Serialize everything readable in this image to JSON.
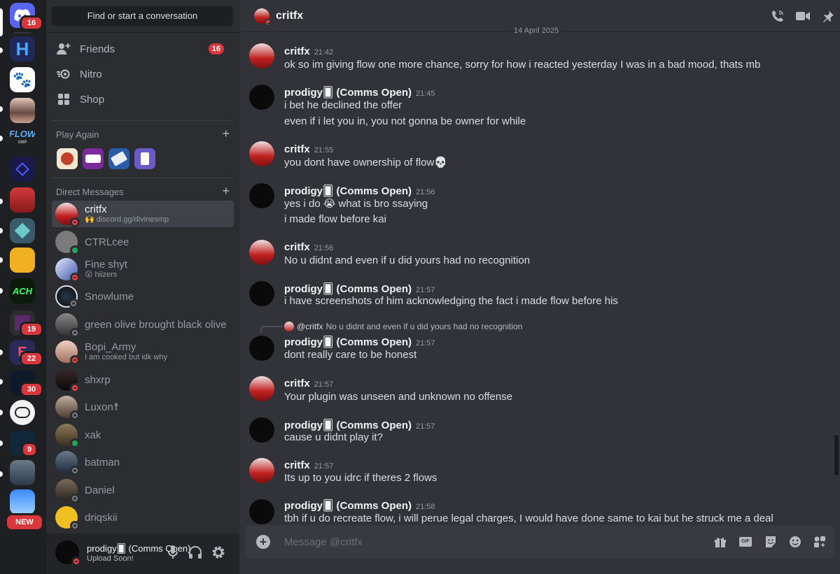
{
  "colors": {
    "accent": "#5865f2",
    "danger": "#da373c",
    "online": "#23a55a"
  },
  "rail": {
    "home_badge": "16",
    "servers": [
      {
        "name": "h-server",
        "badge": ""
      },
      {
        "name": "paw-server",
        "badge": ""
      },
      {
        "name": "photo-server",
        "badge": ""
      },
      {
        "name": "flow-server",
        "label": "FLOW",
        "sub": "SMP",
        "badge": ""
      },
      {
        "name": "blue-server",
        "badge": ""
      },
      {
        "name": "red-hat-server",
        "badge": ""
      },
      {
        "name": "crystal-server",
        "badge": ""
      },
      {
        "name": "gold-server",
        "badge": ""
      },
      {
        "name": "ach-server",
        "label": "ACH",
        "badge": ""
      },
      {
        "name": "purple-server",
        "badge": "19"
      },
      {
        "name": "e-server",
        "badge": "22"
      },
      {
        "name": "dark-server",
        "badge": "30"
      },
      {
        "name": "skull-server",
        "badge": ""
      },
      {
        "name": "night-server",
        "badge": "9"
      },
      {
        "name": "game-server",
        "badge": ""
      },
      {
        "name": "cyan-server",
        "badge": ""
      }
    ],
    "new_label": "NEW"
  },
  "sidebar": {
    "search_placeholder": "Find or start a conversation",
    "nav": [
      {
        "label": "Friends",
        "count": "16"
      },
      {
        "label": "Nitro",
        "count": ""
      },
      {
        "label": "Shop",
        "count": ""
      }
    ],
    "play_again": "Play Again",
    "direct_messages": "Direct Messages",
    "dms": [
      {
        "name": "critfx",
        "sub": "🙌 discord.gg/divinesmp",
        "status": "dnd"
      },
      {
        "name": "CTRLcee",
        "sub": "",
        "status": "online"
      },
      {
        "name": "Fine shyt",
        "sub": "😲 hiizers",
        "status": "dnd"
      },
      {
        "name": "Snowlume",
        "sub": "",
        "status": "off"
      },
      {
        "name": "green olive brought black olive",
        "sub": "",
        "status": "off"
      },
      {
        "name": "Bopi_Army",
        "sub": "I am cooked but idk why",
        "status": "dnd"
      },
      {
        "name": "shxrp",
        "sub": "",
        "status": "dnd"
      },
      {
        "name": "Luxon☨",
        "sub": "",
        "status": "off"
      },
      {
        "name": "xak",
        "sub": "",
        "status": "online"
      },
      {
        "name": "batman",
        "sub": "",
        "status": "off"
      },
      {
        "name": "Daniel",
        "sub": "",
        "status": "off"
      },
      {
        "name": "driqskii",
        "sub": "",
        "status": "off"
      }
    ]
  },
  "user": {
    "name": "prodigy🂠 (Comms Open)",
    "status": "Upload Soon!"
  },
  "header": {
    "name": "critfx"
  },
  "chat": {
    "date_divider": "14 April 2025",
    "messages": [
      {
        "author": "critfx",
        "time": "21:42",
        "lines": [
          "ok so im giving flow one more chance, sorry for how i reacted yesterday I was in a bad mood, thats mb"
        ]
      },
      {
        "author": "prodigy🂠 (Comms Open)",
        "time": "21:45",
        "lines": [
          "i bet he declined the offer",
          "even if i let you in, you not gonna be owner for while"
        ]
      },
      {
        "author": "critfx",
        "time": "21:55",
        "lines": [
          "you dont have ownership of flow💀"
        ]
      },
      {
        "author": "prodigy🂠 (Comms Open)",
        "time": "21:56",
        "lines": [
          "yes i do 😭 what is bro ssaying",
          "i made flow before kai"
        ]
      },
      {
        "author": "critfx",
        "time": "21:56",
        "lines": [
          "No u didnt and even if u did yours had no recognition"
        ]
      },
      {
        "author": "prodigy🂠 (Comms Open)",
        "time": "21:57",
        "lines": [
          "i have screenshots of him acknowledging the fact i made flow before his"
        ]
      },
      {
        "author": "prodigy🂠 (Comms Open)",
        "time": "21:57",
        "reply_to": "@critfx",
        "reply_text": "No u didnt and even if u did yours had no recognition",
        "lines": [
          "dont really care to be honest"
        ]
      },
      {
        "author": "critfx",
        "time": "21:57",
        "lines": [
          "Your plugin was unseen and unknown no offense"
        ]
      },
      {
        "author": "prodigy🂠 (Comms Open)",
        "time": "21:57",
        "lines": [
          "cause u didnt play it?"
        ]
      },
      {
        "author": "critfx",
        "time": "21:57",
        "lines": [
          "Its up to you idrc if theres 2 flows"
        ]
      },
      {
        "author": "prodigy🂠 (Comms Open)",
        "time": "21:58",
        "lines": [
          "tbh if u do recreate flow, i will perue legal charges, I would have done same to kai but he struck me a deal"
        ]
      }
    ]
  },
  "composer": {
    "placeholder": "Message @critfx",
    "gif_label": "GIF"
  }
}
